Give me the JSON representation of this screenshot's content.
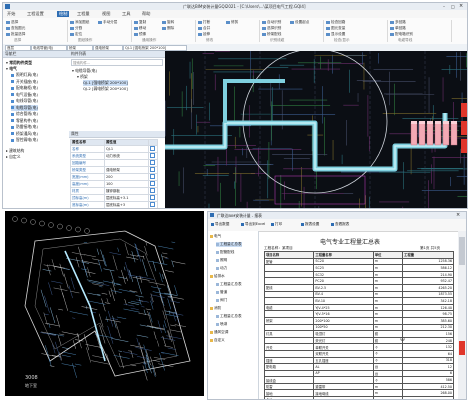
{
  "app1": {
    "title": "广联达BIM安装计量GQI2021 - [C:\\Users\\...\\某项目电气工程.GQI4]",
    "menus": [
      "开始",
      "工程设置",
      "绘制",
      "工程量",
      "视图",
      "工具",
      "帮助"
    ],
    "active_menu": "绘制",
    "ribbon_groups": [
      {
        "label": "选择",
        "items": [
          "选择",
          "查找图元",
          "批量选择"
        ]
      },
      {
        "label": "图纸操作",
        "items": [
          "添加图纸",
          "分割",
          "定位",
          "手动分层"
        ]
      },
      {
        "label": "通用操作",
        "items": [
          "复制",
          "移动",
          "镜像",
          "旋转",
          "删除"
        ]
      },
      {
        "label": "修改",
        "items": [
          "打断",
          "合并",
          "延伸",
          "修剪"
        ]
      },
      {
        "label": "识别线缆",
        "items": [
          "自动识别",
          "选择识别",
          "桥架配线",
          "设置起点"
        ]
      },
      {
        "label": "检查/显示",
        "items": [
          "检查回路",
          "图元查量",
          "显示设置"
        ]
      },
      {
        "label": "电缆导线",
        "items": [
          "多回路",
          "单回路",
          "配电箱识别"
        ]
      }
    ],
    "toolbar": {
      "floor": "首层",
      "type": "电线导管(电)",
      "category": "桥架",
      "sub": "强电桥架",
      "name": "QJ-1 [强电桥架 200*100]"
    },
    "nav": {
      "header": "导航栏",
      "sections": [
        "常用构件类型",
        "电气"
      ],
      "items": [
        "照明灯具(电)",
        "开关插座(电)",
        "配电箱柜(电)",
        "电气设备(电)",
        "电线导管(电)",
        "电缆导管(电)",
        "综合管线(电)",
        "零星构件(电)",
        "防雷接地(电)",
        "桥架通风(电)",
        "智控弱电(电)"
      ],
      "selected": "电缆导管(电)",
      "footer": [
        "建筑结构",
        "自定义"
      ]
    },
    "components": {
      "header": "构件列表",
      "search_placeholder": "搜索构件...",
      "tree": [
        "电缆导管(电)",
        "桥架",
        "QJ-1 [强电桥架 200*100]",
        "QJ-2 [弱电桥架 200*100]"
      ],
      "selected": "QJ-1 [强电桥架 200*100]"
    },
    "properties": {
      "header": "属性",
      "columns": [
        "属性名称",
        "属性值"
      ],
      "rows": [
        [
          "名称",
          "QJ-1"
        ],
        [
          "系统类型",
          "动力系统"
        ],
        [
          "回路编号",
          ""
        ],
        [
          "桥架类型",
          "强电桥架"
        ],
        [
          "宽度(mm)",
          "200"
        ],
        [
          "高度(mm)",
          "100"
        ],
        [
          "材质",
          "镀锌钢板"
        ],
        [
          "顶标高(m)",
          "层底标高+3.1"
        ],
        [
          "底标高(m)",
          "层底标高+3"
        ],
        [
          "汇总信息",
          "桥架(电)"
        ],
        [
          "是否计量",
          "是"
        ],
        [
          "备注",
          ""
        ]
      ]
    },
    "side_tab_color": "#e0362b"
  },
  "cad2": {
    "labels": [
      "3008",
      "地下室"
    ]
  },
  "app2": {
    "title": "广联达BIM安装计量 - 报表",
    "tools": [
      "导出数据",
      "导出到Excel",
      "打印",
      "报表设置",
      "查看报表"
    ],
    "nav": {
      "items": [
        "电气",
        "工程量汇总表",
        "配管配线",
        "照明",
        "动力",
        "给排水",
        "工程量汇总表",
        "管道",
        "阀门",
        "消防",
        "工程量汇总表",
        "喷淋",
        "通风空调",
        "自定义"
      ],
      "selected": "工程量汇总表"
    },
    "doc": {
      "title": "电气专业工程量汇总表",
      "meta_left": "工程名称：某项目",
      "meta_right": "第1页 共5页",
      "headers": [
        "项目名称",
        "工程量名称",
        "单位",
        "工程量"
      ],
      "rows": [
        [
          "配管",
          "SC20",
          "m",
          "1258.36"
        ],
        [
          "",
          "SC25",
          "m",
          "586.12"
        ],
        [
          "",
          "SC32",
          "m",
          "214.90"
        ],
        [
          "",
          "PC20",
          "m",
          "932.47"
        ],
        [
          "配线",
          "BV-2.5",
          "m",
          "4265.20"
        ],
        [
          "",
          "BV-4",
          "m",
          "1873.55"
        ],
        [
          "",
          "BV-10",
          "m",
          "342.18"
        ],
        [
          "电缆",
          "YJV-4*25",
          "m",
          "126.40"
        ],
        [
          "",
          "YJV-5*16",
          "m",
          "98.75"
        ],
        [
          "桥架",
          "200*100",
          "m",
          "385.60"
        ],
        [
          "",
          "100*50",
          "m",
          "212.30"
        ],
        [
          "灯具",
          "吸顶灯",
          "套",
          "156"
        ],
        [
          "",
          "荧光灯",
          "套",
          "248"
        ],
        [
          "开关",
          "单联开关",
          "个",
          "132"
        ],
        [
          "",
          "双联开关",
          "个",
          "64"
        ],
        [
          "插座",
          "五孔插座",
          "个",
          "318"
        ],
        [
          "配电箱",
          "AL",
          "台",
          "12"
        ],
        [
          "",
          "AP",
          "台",
          "6"
        ],
        [
          "接线盒",
          "",
          "个",
          "586"
        ],
        [
          "防雷",
          "避雷带",
          "m",
          "412.50"
        ],
        [
          "接地",
          "接地母线",
          "m",
          "268.00"
        ],
        [
          "合计",
          "",
          "",
          ""
        ]
      ]
    },
    "accent": "#2e6db3"
  }
}
